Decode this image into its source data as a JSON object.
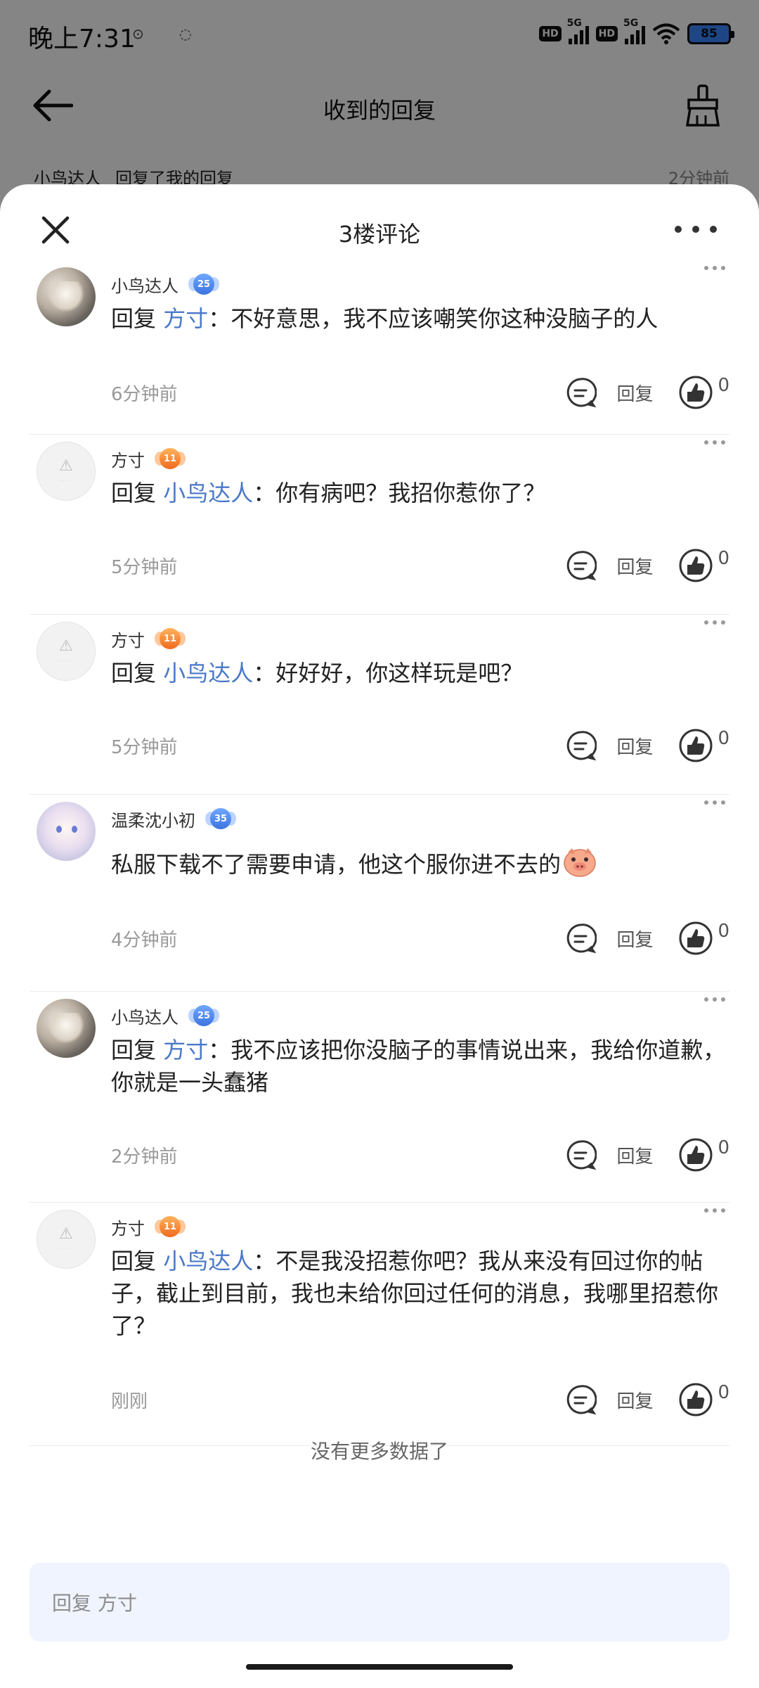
{
  "status_bar": {
    "time": "晚上7:31",
    "hd": "HD",
    "net": "5G",
    "battery": "85"
  },
  "background_page": {
    "title": "收到的回复",
    "preview_name": "小鸟达人",
    "preview_text": "回复了我的回复",
    "preview_time": "2分钟前"
  },
  "sheet": {
    "title": "3楼评论",
    "no_more": "没有更多数据了",
    "reply_placeholder": "回复 方寸",
    "reply_label": "回复"
  },
  "comments": [
    {
      "name": "小鸟达人",
      "level": "25",
      "badge": "blue",
      "avatar": "bird",
      "reply_prefix": "回复",
      "reply_to": "方寸",
      "colon": "：",
      "text": "不好意思，我不应该嘲笑你这种没脑子的人",
      "time": "6分钟前",
      "likes": "0"
    },
    {
      "name": "方寸",
      "level": "11",
      "badge": "orange",
      "avatar": "blank",
      "reply_prefix": "回复",
      "reply_to": "小鸟达人",
      "colon": "：",
      "text": "你有病吧？我招你惹你了？",
      "time": "5分钟前",
      "likes": "0"
    },
    {
      "name": "方寸",
      "level": "11",
      "badge": "orange",
      "avatar": "blank",
      "reply_prefix": "回复",
      "reply_to": "小鸟达人",
      "colon": "：",
      "text": "好好好，你这样玩是吧？",
      "time": "5分钟前",
      "likes": "0"
    },
    {
      "name": "温柔沈小初",
      "level": "35",
      "badge": "blue",
      "avatar": "girl",
      "text": "私服下载不了需要申请，他这个服你进不去的",
      "emoji": "pig-emoji",
      "time": "4分钟前",
      "likes": "0"
    },
    {
      "name": "小鸟达人",
      "level": "25",
      "badge": "blue",
      "avatar": "bird",
      "reply_prefix": "回复",
      "reply_to": "方寸",
      "colon": "：",
      "text": "我不应该把你没脑子的事情说出来，我给你道歉，你就是一头蠢猪",
      "time": "2分钟前",
      "likes": "0"
    },
    {
      "name": "方寸",
      "level": "11",
      "badge": "orange",
      "avatar": "blank",
      "reply_prefix": "回复",
      "reply_to": "小鸟达人",
      "colon": "：",
      "text": "不是我没招惹你吧？我从来没有回过你的帖子，截止到目前，我也未给你回过任何的消息，我哪里招惹你了？",
      "time": "刚刚",
      "likes": "0"
    }
  ],
  "colors": {
    "accent": "#4a78c9",
    "input_bg": "#f0f4ff",
    "badge_blue": "#3c74e0",
    "badge_orange": "#f06a1f"
  }
}
